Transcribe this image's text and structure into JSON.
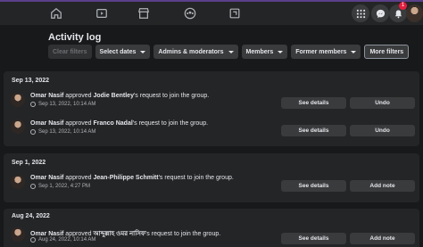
{
  "topnav": {
    "icons": [
      "home-icon",
      "watch-icon",
      "marketplace-icon",
      "groups-icon",
      "gaming-icon"
    ],
    "notification_count": "1"
  },
  "page": {
    "title": "Activity log"
  },
  "filters": {
    "clear": "Clear filters",
    "dates": "Select dates",
    "admins": "Admins & moderators",
    "members": "Members",
    "former": "Former members",
    "more": "More filters"
  },
  "actions": {
    "see_details": "See details",
    "undo": "Undo",
    "add_note": "Add note"
  },
  "groups": [
    {
      "date": "Sep 13, 2022",
      "entries": [
        {
          "actor": "Omar Nasif",
          "verb": " approved ",
          "target": "Jodie Bentley",
          "suffix": "'s request to join the group.",
          "time": "Sep 13, 2022, 10:14 AM"
        },
        {
          "actor": "Omar Nasif",
          "verb": " approved ",
          "target": "Franco Nadal",
          "suffix": "'s request to join the group.",
          "time": "Sep 13, 2022, 10:14 AM"
        }
      ]
    },
    {
      "date": "Sep 1, 2022",
      "entries": [
        {
          "actor": "Omar Nasif",
          "verb": " approved ",
          "target": "Jean-Philippe Schmitt",
          "suffix": "'s request to join the group.",
          "time": "Sep 1, 2022, 4:27 PM"
        }
      ]
    },
    {
      "date": "Aug 24, 2022",
      "entries": [
        {
          "actor": "Omar Nasif",
          "verb": " approved ",
          "target": "আব্দুল্লাহ ওমর নাসিফ",
          "suffix": "'s request to join the group.",
          "time": "Aug 24, 2022, 10:14 AM"
        }
      ]
    }
  ]
}
